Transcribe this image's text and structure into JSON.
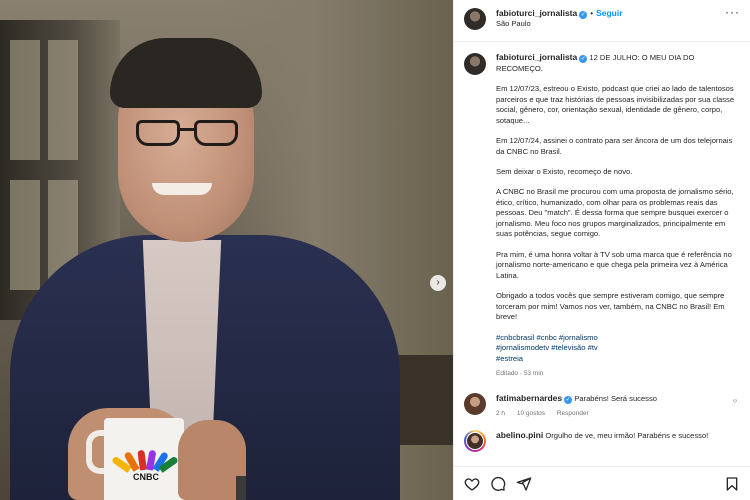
{
  "header": {
    "username": "fabioturci_jornalista",
    "dot": "•",
    "follow_label": "Seguir",
    "location": "São Paulo"
  },
  "caption": {
    "username": "fabioturci_jornalista",
    "headline": "12 DE JULHO: O MEU DIA DO RECOMEÇO.",
    "paragraphs": [
      "Em 12/07/23, estreou o Existo, podcast que criei ao lado de talentosos parceiros e que traz histórias de pessoas invisibilizadas por sua classe social, gênero, cor, orientação sexual, identidade de gênero, corpo, sotaque...",
      "Em 12/07/24, assinei o contrato para ser âncora de um dos telejornais da CNBC no Brasil.",
      "Sem deixar o Existo, recomeço de novo.",
      "A CNBC no Brasil me procurou com uma proposta de jornalismo sério, ético, crítico, humanizado, com olhar para os problemas reais das pessoas. Deu \"match\". É dessa forma que sempre busquei exercer o jornalismo. Meu foco nos grupos marginalizados, principalmente em suas potências, segue comigo.",
      "Pra mim, é uma honra voltar à TV sob uma marca que é referência no jornalismo norte-americano e que chega pela primeira vez à América Latina.",
      "Obrigado a todos vocês que sempre estiveram comigo, que sempre torceram por mim! Vamos nos ver, também, na CNBC no Brasil! Em breve!"
    ],
    "hashtag_lines": [
      "#cnbcbrasil #cnbc #jornalismo",
      "#jornalismodetv #televisão #tv",
      "#estreia"
    ],
    "edited": "Editado · 53 min"
  },
  "comments": [
    {
      "username": "fatimabernardes",
      "text": "Parabéns! Será sucesso",
      "time": "2 h",
      "likes": "10 gostos",
      "reply": "Responder"
    },
    {
      "username": "abelino.pini",
      "text": "Orgulho de ve, meu irmão! Parabéns e sucesso!"
    }
  ],
  "media": {
    "mug_text": "CNBC",
    "next_glyph": "›"
  },
  "icons": [
    "heart-icon",
    "comment-icon",
    "share-icon",
    "bookmark-icon"
  ],
  "colors": {
    "accent": "#0095f6",
    "verified": "#3797f0",
    "hashtag": "#00376b"
  }
}
